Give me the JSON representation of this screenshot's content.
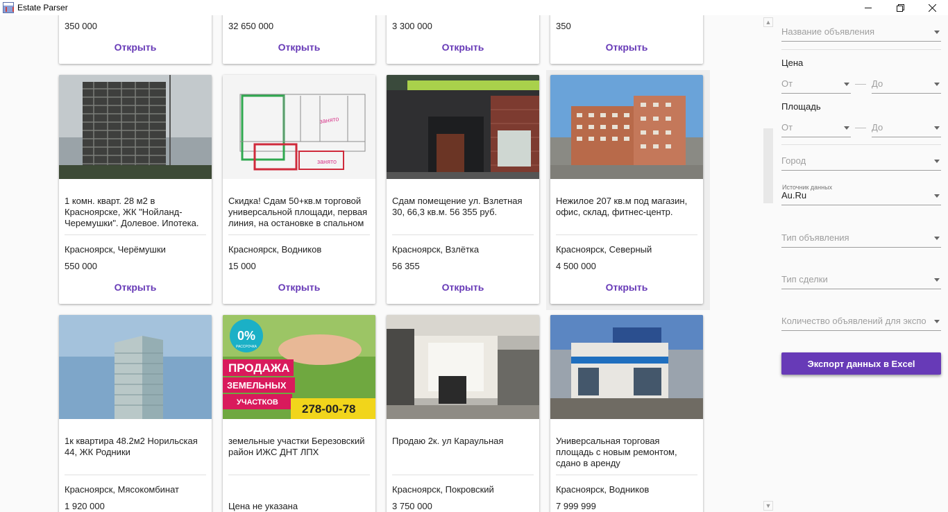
{
  "window": {
    "title": "Estate Parser"
  },
  "cards_row0": [
    {
      "price": "350 000",
      "open": "Открыть"
    },
    {
      "price": "32 650 000",
      "open": "Открыть"
    },
    {
      "price": "3 300 000",
      "open": "Открыть"
    },
    {
      "price": "350",
      "open": "Открыть"
    }
  ],
  "cards_row1": [
    {
      "title": "1 комн. кварт.  28 м2 в Красноярске, ЖК \"Нойланд-Черемушки\". Долевое. Ипотека.",
      "location": "Красноярск, Черёмушки",
      "price": "550 000",
      "open": "Открыть"
    },
    {
      "title": "Скидка! Сдам 50+кв.м торговой универсальной площади, первая линия, на остановке в спальном",
      "location": "Красноярск, Водников",
      "price": "15 000",
      "open": "Открыть"
    },
    {
      "title": "Сдам помещение ул. Взлетная 30,  66,3 кв.м.  56 355 руб.",
      "location": "Красноярск, Взлётка",
      "price": "56 355",
      "open": "Открыть"
    },
    {
      "title": "Нежилое 207 кв.м под магазин, офис, склад, фитнес-центр.",
      "location": "Красноярск, Северный",
      "price": "4 500 000",
      "open": "Открыть"
    }
  ],
  "cards_row2": [
    {
      "title": "1к квартира 48.2м2 Норильская 44, ЖК Родники",
      "location": "Красноярск, Мясокомбинат",
      "price": "1 920 000"
    },
    {
      "title": "земельные участки Березовский район ИЖС ДНТ ЛПХ",
      "location": "",
      "price": "Цена не указана"
    },
    {
      "title": "Продаю 2к. ул Караульная",
      "location": "Красноярск, Покровский",
      "price": "3 750 000"
    },
    {
      "title": "Универсальная торговая площадь с новым ремонтом, сдано в аренду",
      "location": "Красноярск, Водников",
      "price": "7 999 999"
    }
  ],
  "ad_banner": {
    "percent": "0%",
    "installment": "РАССРОЧКА",
    "line1": "ПРОДАЖА",
    "line2": "ЗЕМЕЛЬНЫХ",
    "line3": "УЧАСТКОВ",
    "phone": "278-00-78"
  },
  "plan_labels": {
    "taken1": "занято",
    "taken2": "занято"
  },
  "filters": {
    "name_placeholder": "Название объявления",
    "price_label": "Цена",
    "price_from": "От",
    "price_to": "До",
    "area_label": "Площадь",
    "area_from": "От",
    "area_to": "До",
    "city_placeholder": "Город",
    "source_label": "Источник данных",
    "source_value": "Au.Ru",
    "ad_type_placeholder": "Тип объявления",
    "deal_type_placeholder": "Тип сделки",
    "count_placeholder": "Количество объявлений для экспо",
    "export_button": "Экспорт данных в Excel"
  },
  "colors": {
    "accent": "#673ab7"
  },
  "icons": {
    "minimize": "minimize-icon",
    "maximize": "restore-icon",
    "close": "close-icon"
  }
}
